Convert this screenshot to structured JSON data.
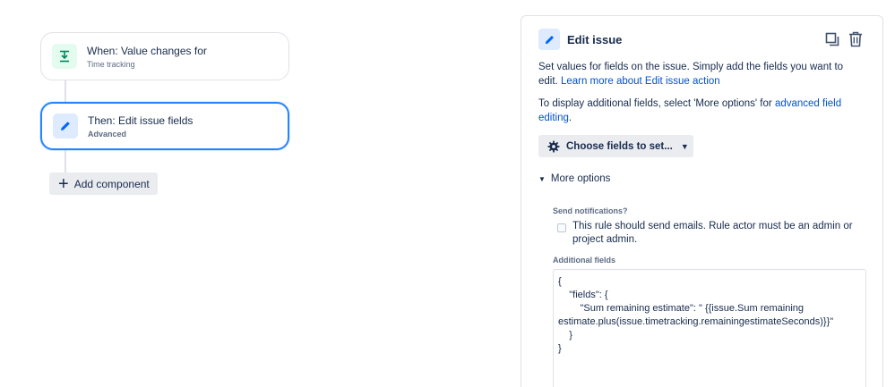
{
  "flow": {
    "trigger": {
      "title": "When: Value changes for",
      "subtitle": "Time tracking",
      "icon": "trigger-icon"
    },
    "action": {
      "title": "Then: Edit issue fields",
      "subtitle": "Advanced",
      "icon": "pencil-icon"
    },
    "add_component_label": "Add component"
  },
  "panel": {
    "title": "Edit issue",
    "description_text": "Set values for fields on the issue. Simply add the fields you want to edit.",
    "description_link": "Learn more about Edit issue action",
    "advanced_text": "To display additional fields, select 'More options' for",
    "advanced_link": "advanced field editing",
    "advanced_suffix": ".",
    "choose_fields_label": "Choose fields to set...",
    "more_options_label": "More options",
    "send_notifications_label": "Send notifications?",
    "send_notifications_text": "This rule should send emails. Rule actor must be an admin or project admin.",
    "additional_fields_label": "Additional fields",
    "additional_fields_value": "{\n    \"fields\": {\n        \"Sum remaining estimate\": \" {{issue.Sum remaining estimate.plus(issue.timetracking.remainingestimateSeconds)}}\"\n    }\n}"
  },
  "colors": {
    "accent": "#0052cc",
    "selected_border": "#2684ff",
    "trigger_bg": "#e3fcef",
    "trigger_fg": "#00875a",
    "action_bg": "#deebff",
    "action_fg": "#0065ff"
  }
}
